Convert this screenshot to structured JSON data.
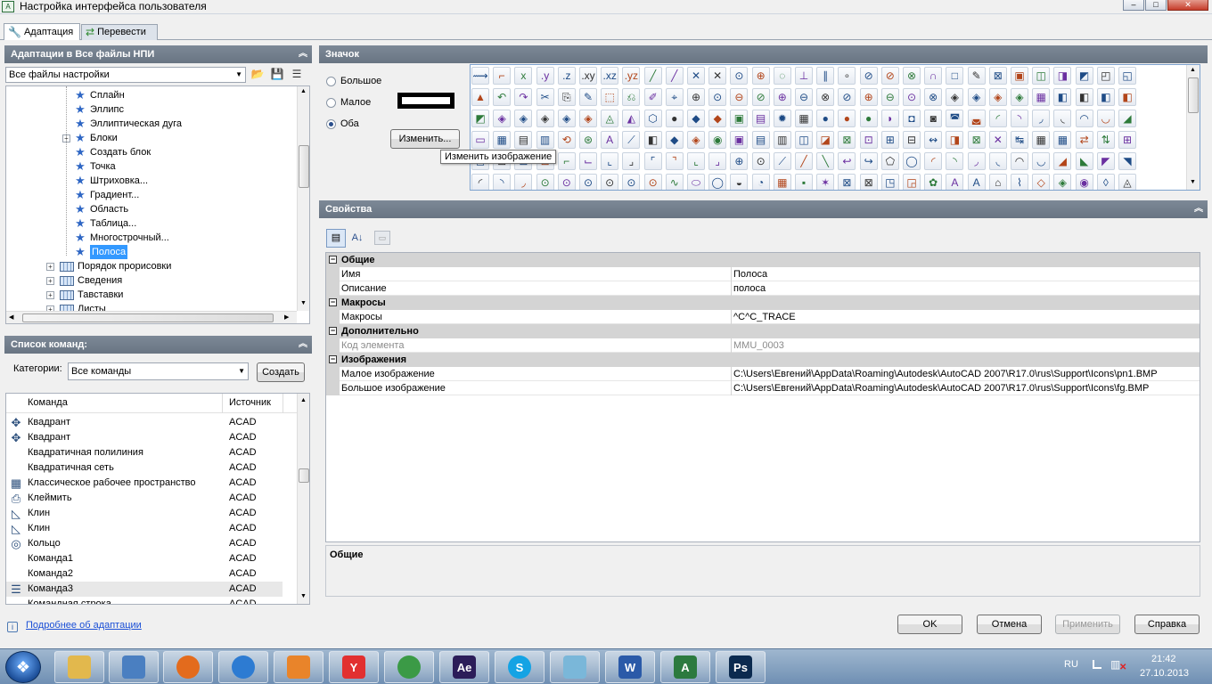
{
  "window": {
    "title": "Настройка интерфейса пользователя",
    "app_icon": "A"
  },
  "tabs": [
    {
      "label": "Адаптация",
      "icon": "wrench-icon"
    },
    {
      "label": "Перевести",
      "icon": "transfer-icon"
    }
  ],
  "left_top": {
    "header": "Адаптации в Все файлы НПИ",
    "combo_value": "Все файлы настройки",
    "tree": [
      {
        "label": "Сплайн",
        "icon": "star-icon"
      },
      {
        "label": "Эллипс",
        "icon": "star-icon"
      },
      {
        "label": "Эллиптическая дуга",
        "icon": "star-icon"
      },
      {
        "label": "Блоки",
        "icon": "star-icon",
        "expander": "+"
      },
      {
        "label": "Создать блок",
        "icon": "star-icon"
      },
      {
        "label": "Точка",
        "icon": "star-icon"
      },
      {
        "label": "Штриховка...",
        "icon": "star-icon"
      },
      {
        "label": "Градиент...",
        "icon": "star-icon"
      },
      {
        "label": "Область",
        "icon": "star-icon"
      },
      {
        "label": "Таблица...",
        "icon": "star-icon"
      },
      {
        "label": "Многострочный...",
        "icon": "star-icon"
      },
      {
        "label": "Полоса",
        "icon": "star-icon",
        "selected": true
      },
      {
        "label": "Порядок прорисовки",
        "icon": "toolbar-icon",
        "expander": "+"
      },
      {
        "label": "Сведения",
        "icon": "toolbar-icon",
        "expander": "+"
      },
      {
        "label": "Тавставки",
        "icon": "toolbar-icon",
        "expander": "+"
      },
      {
        "label": "Листы",
        "icon": "toolbar-icon",
        "expander": "+"
      }
    ]
  },
  "left_bottom": {
    "header": "Список команд:",
    "categories_label": "Категории:",
    "categories_value": "Все команды",
    "create_button": "Создать",
    "columns": [
      "Команда",
      "Источник"
    ],
    "rows": [
      {
        "name": "Квадрант",
        "src": "ACAD",
        "icon": "quadrant-icon"
      },
      {
        "name": "Квадрант",
        "src": "ACAD",
        "icon": "quadrant-icon"
      },
      {
        "name": "Квадратичная полилиния",
        "src": "ACAD",
        "icon": ""
      },
      {
        "name": "Квадратичная сеть",
        "src": "ACAD",
        "icon": ""
      },
      {
        "name": "Классическое рабочее пространство",
        "src": "ACAD",
        "icon": "workspace-icon"
      },
      {
        "name": "Клеймить",
        "src": "ACAD",
        "icon": "stamp-icon"
      },
      {
        "name": "Клин",
        "src": "ACAD",
        "icon": "wedge-icon"
      },
      {
        "name": "Клин",
        "src": "ACAD",
        "icon": "wedge-icon"
      },
      {
        "name": "Кольцо",
        "src": "ACAD",
        "icon": "donut-icon"
      },
      {
        "name": "Команда1",
        "src": "ACAD",
        "icon": ""
      },
      {
        "name": "Команда2",
        "src": "ACAD",
        "icon": ""
      },
      {
        "name": "Команда3",
        "src": "ACAD",
        "icon": "trace-icon",
        "highlighted": true
      },
      {
        "name": "Командная строка",
        "src": "ACAD",
        "icon": ""
      }
    ]
  },
  "link": "Подробнее об адаптации",
  "icon_panel": {
    "header": "Значок",
    "radios": [
      {
        "label": "Большое",
        "checked": false
      },
      {
        "label": "Малое",
        "checked": false
      },
      {
        "label": "Оба",
        "checked": true
      }
    ],
    "edit_button": "Изменить...",
    "tooltip": "Изменить изображение",
    "grid_row1": [
      "⟿",
      "⌐",
      "x",
      ".y",
      ".z",
      ".xy",
      ".xz",
      ".yz",
      "╱",
      "╱",
      "✕",
      "✕",
      "⊙",
      "⊕",
      "◌",
      "⊥",
      "∥",
      "∘",
      "⊘",
      "⊘",
      "⊗",
      "∩",
      "□",
      "✎",
      "⊠",
      "▣",
      "◫",
      "◨",
      "◩",
      "◰",
      "◱"
    ],
    "grid_row2": [
      "▲",
      "↶",
      "↷",
      "✂",
      "⎘",
      "✎",
      "⬚",
      "⎌",
      "✐",
      "⌖",
      "⊕",
      "⊙",
      "⊖",
      "⊘",
      "⊕",
      "⊖",
      "⊗",
      "⊘",
      "⊕",
      "⊖",
      "⊙",
      "⊗",
      "◈",
      "◈",
      "◈",
      "◈",
      "▦",
      "◧",
      "◧",
      "◧",
      "◧"
    ],
    "grid_row3": [
      "◩",
      "◈",
      "◈",
      "◈",
      "◈",
      "◈",
      "◬",
      "◭",
      "⬡",
      "●",
      "◆",
      "◆",
      "▣",
      "▤",
      "✹",
      "▦",
      "●",
      "●",
      "●",
      "◗",
      "◘",
      "◙",
      "◚",
      "◛",
      "◜",
      "◝",
      "◞",
      "◟",
      "◠",
      "◡",
      "◢"
    ],
    "grid_row4": [
      "▭",
      "▦",
      "▤",
      "▥",
      "⟲",
      "⊛",
      "A",
      "⟋",
      "◧",
      "◆",
      "◈",
      "◉",
      "▣",
      "▤",
      "▥",
      "◫",
      "◪",
      "⊠",
      "⊡",
      "⊞",
      "⊟",
      "↭",
      "◨",
      "⊠",
      "✕",
      "↹",
      "▦",
      "▦",
      "⇄",
      "⇅",
      "⊞"
    ],
    "grid_row5": [
      "◻",
      "⊡",
      "⊟",
      "⊞",
      "⌐",
      "⌙",
      "⌞",
      "⌟",
      "⌜",
      "⌝",
      "⌞",
      "⌟",
      "⊕",
      "⊙",
      "⟋",
      "╱",
      "╲",
      "↩",
      "↪",
      "⬠",
      "◯",
      "◜",
      "◝",
      "◞",
      "◟",
      "◠",
      "◡",
      "◢",
      "◣",
      "◤",
      "◥"
    ],
    "grid_row6": [
      "◜",
      "◝",
      "◞",
      "⊙",
      "⊙",
      "⊙",
      "⊙",
      "⊙",
      "⊙",
      "∿",
      "⬭",
      "◯",
      "◒",
      "◔",
      "▦",
      "▪",
      "✶",
      "⊠",
      "⊠",
      "◳",
      "◲",
      "✿",
      "A",
      "A",
      "⌂",
      "⌇",
      "◇",
      "◈",
      "◉",
      "◊",
      "◬"
    ]
  },
  "properties": {
    "header": "Свойства",
    "rows": [
      {
        "kind": "cat",
        "name": "Общие"
      },
      {
        "kind": "item",
        "name": "Имя",
        "value": "Полоса"
      },
      {
        "kind": "item",
        "name": "Описание",
        "value": "полоса"
      },
      {
        "kind": "cat",
        "name": "Макросы"
      },
      {
        "kind": "item",
        "name": "Макросы",
        "value": "^C^C_TRACE"
      },
      {
        "kind": "cat",
        "name": "Дополнительно"
      },
      {
        "kind": "grey",
        "name": "Код элемента",
        "value": "MMU_0003"
      },
      {
        "kind": "cat",
        "name": "Изображения"
      },
      {
        "kind": "item",
        "name": "Малое изображение",
        "value": "C:\\Users\\Евгений\\AppData\\Roaming\\Autodesk\\AutoCAD 2007\\R17.0\\rus\\Support\\Icons\\pn1.BMP"
      },
      {
        "kind": "item",
        "name": "Большое изображение",
        "value": "C:\\Users\\Евгений\\AppData\\Roaming\\Autodesk\\AutoCAD 2007\\R17.0\\rus\\Support\\Icons\\fg.BMP"
      }
    ],
    "description_title": "Общие"
  },
  "buttons": {
    "ok": "OK",
    "cancel": "Отмена",
    "apply": "Применить",
    "help": "Справка"
  },
  "taskbar": {
    "lang": "RU",
    "time": "21:42",
    "date": "27.10.2013",
    "apps": [
      {
        "name": "explorer-icon",
        "color": "#e2b84d"
      },
      {
        "name": "calendar-icon",
        "color": "#4a7fc1"
      },
      {
        "name": "firefox-icon",
        "color": "#e36b1d"
      },
      {
        "name": "ie-icon",
        "color": "#2d7bd2"
      },
      {
        "name": "media-icon",
        "color": "#e9842a"
      },
      {
        "name": "yandex-icon",
        "color": "#e23030"
      },
      {
        "name": "chrome-icon",
        "color": "#3b9a46"
      },
      {
        "name": "aftereffects-icon",
        "color": "#2c1d59"
      },
      {
        "name": "skype-icon",
        "color": "#14a3e4"
      },
      {
        "name": "notes-icon",
        "color": "#7ab7d9"
      },
      {
        "name": "word-icon",
        "color": "#2b5aa8"
      },
      {
        "name": "autocad-icon",
        "color": "#2c7a3f"
      },
      {
        "name": "photoshop-icon",
        "color": "#0b2a4f"
      }
    ],
    "app_labels": {
      "aftereffects": "Ae",
      "photoshop": "Ps",
      "yandex": "Y",
      "skype": "S",
      "word": "W",
      "autocad": "A"
    }
  }
}
